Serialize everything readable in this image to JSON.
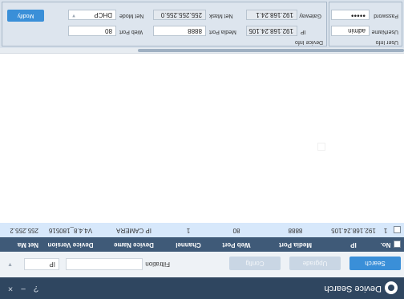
{
  "app": {
    "title": "Device Search"
  },
  "window_controls": [
    "?",
    "−",
    "×"
  ],
  "toolbar": {
    "search_label": "Search",
    "upgrade_label": "Upgrade",
    "config_label": "Config",
    "filtration_label": "Filtration",
    "filtration_value": "",
    "filter_type": "IP"
  },
  "table": {
    "columns": [
      "No.",
      "IP",
      "Media Port",
      "Web Port",
      "Channel",
      "Device Name",
      "Device Version",
      "Net Ma"
    ],
    "rows": [
      {
        "no": "1",
        "ip": "192.168.24.105",
        "media_port": "8888",
        "web_port": "80",
        "channel": "1",
        "device_name": "IP CAMERA",
        "device_version": "V4.4.8_180516",
        "net_mask": "255.255.2"
      }
    ]
  },
  "user_info": {
    "label": "User Info",
    "username_label": "UserName",
    "username": "admin",
    "password_label": "Password",
    "password": "●●●●●"
  },
  "device_info": {
    "label": "Device Info",
    "ip_label": "IP",
    "ip": "192.168.24.105",
    "gateway_label": "Gateway",
    "gateway": "192.168.24.1",
    "media_port_label": "Media Port",
    "media_port": "8888",
    "net_mask_label": "Net Mask",
    "net_mask": "255.255.255.0",
    "web_port_label": "Web Port",
    "web_port": "80",
    "net_mode_label": "Net Mode",
    "net_mode": "DHCP",
    "modify_label": "Modify"
  },
  "colors": {
    "titlebar": "#2f4660",
    "accent": "#3a8fd8",
    "table_header": "#3f5a78",
    "selected_row": "#d7e8fb"
  }
}
